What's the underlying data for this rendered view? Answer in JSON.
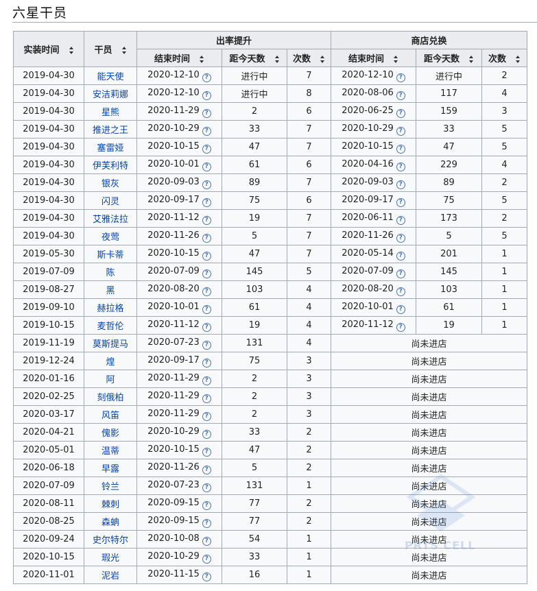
{
  "title": "六星干员",
  "headers": {
    "implement": "实装时间",
    "operator": "干员",
    "rateup_group": "出率提升",
    "shop_group": "商店兑换",
    "end_time": "结束时间",
    "days_ago": "距今天数",
    "count": "次数"
  },
  "no_shop": "尚未进店",
  "watermark": "PRTS CELL",
  "colors": {
    "ongoing": "#148014",
    "long": "#dd3333",
    "link": "#0645ad"
  },
  "rows": [
    {
      "impl": "2019-04-30",
      "name": "能天使",
      "r_end": "2020-12-10",
      "r_days": "进行中",
      "r_cnt": "7",
      "s_end": "2020-12-10",
      "s_days": "进行中",
      "s_cnt": "2"
    },
    {
      "impl": "2019-04-30",
      "name": "安洁莉娜",
      "r_end": "2020-12-10",
      "r_days": "进行中",
      "r_cnt": "8",
      "s_end": "2020-08-06",
      "s_days": "117",
      "s_cnt": "4"
    },
    {
      "impl": "2019-04-30",
      "name": "星熊",
      "r_end": "2020-11-29",
      "r_days": "2",
      "r_cnt": "6",
      "s_end": "2020-06-25",
      "s_days": "159",
      "s_cnt": "3"
    },
    {
      "impl": "2019-04-30",
      "name": "推进之王",
      "r_end": "2020-10-29",
      "r_days": "33",
      "r_cnt": "7",
      "s_end": "2020-10-29",
      "s_days": "33",
      "s_cnt": "5"
    },
    {
      "impl": "2019-04-30",
      "name": "塞雷娅",
      "r_end": "2020-10-15",
      "r_days": "47",
      "r_cnt": "7",
      "s_end": "2020-10-15",
      "s_days": "47",
      "s_cnt": "5"
    },
    {
      "impl": "2019-04-30",
      "name": "伊芙利特",
      "r_end": "2020-10-01",
      "r_days": "61",
      "r_cnt": "6",
      "s_end": "2020-04-16",
      "s_days": "229",
      "s_cnt": "4"
    },
    {
      "impl": "2019-04-30",
      "name": "银灰",
      "r_end": "2020-09-03",
      "r_days": "89",
      "r_cnt": "7",
      "s_end": "2020-09-03",
      "s_days": "89",
      "s_cnt": "2"
    },
    {
      "impl": "2019-04-30",
      "name": "闪灵",
      "r_end": "2020-09-17",
      "r_days": "75",
      "r_cnt": "6",
      "s_end": "2020-09-17",
      "s_days": "75",
      "s_cnt": "5"
    },
    {
      "impl": "2019-04-30",
      "name": "艾雅法拉",
      "r_end": "2020-11-12",
      "r_days": "19",
      "r_cnt": "7",
      "s_end": "2020-06-11",
      "s_days": "173",
      "s_cnt": "2"
    },
    {
      "impl": "2019-04-30",
      "name": "夜莺",
      "r_end": "2020-11-26",
      "r_days": "5",
      "r_cnt": "7",
      "s_end": "2020-11-26",
      "s_days": "5",
      "s_cnt": "5"
    },
    {
      "impl": "2019-05-30",
      "name": "斯卡蒂",
      "r_end": "2020-10-15",
      "r_days": "47",
      "r_cnt": "7",
      "s_end": "2020-05-14",
      "s_days": "201",
      "s_cnt": "1"
    },
    {
      "impl": "2019-07-09",
      "name": "陈",
      "r_end": "2020-07-09",
      "r_days": "145",
      "r_cnt": "5",
      "s_end": "2020-07-09",
      "s_days": "145",
      "s_cnt": "1"
    },
    {
      "impl": "2019-08-27",
      "name": "黑",
      "r_end": "2020-08-20",
      "r_days": "103",
      "r_cnt": "4",
      "s_end": "2020-08-20",
      "s_days": "103",
      "s_cnt": "1"
    },
    {
      "impl": "2019-09-10",
      "name": "赫拉格",
      "r_end": "2020-10-01",
      "r_days": "61",
      "r_cnt": "4",
      "s_end": "2020-10-01",
      "s_days": "61",
      "s_cnt": "1"
    },
    {
      "impl": "2019-10-15",
      "name": "麦哲伦",
      "r_end": "2020-11-12",
      "r_days": "19",
      "r_cnt": "4",
      "s_end": "2020-11-12",
      "s_days": "19",
      "s_cnt": "1"
    },
    {
      "impl": "2019-11-19",
      "name": "莫斯提马",
      "r_end": "2020-07-23",
      "r_days": "131",
      "r_cnt": "4"
    },
    {
      "impl": "2019-12-24",
      "name": "煌",
      "r_end": "2020-09-17",
      "r_days": "75",
      "r_cnt": "3"
    },
    {
      "impl": "2020-01-16",
      "name": "阿",
      "r_end": "2020-11-29",
      "r_days": "2",
      "r_cnt": "3"
    },
    {
      "impl": "2020-02-25",
      "name": "刻俄柏",
      "r_end": "2020-11-29",
      "r_days": "2",
      "r_cnt": "3"
    },
    {
      "impl": "2020-03-17",
      "name": "风笛",
      "r_end": "2020-11-29",
      "r_days": "2",
      "r_cnt": "3"
    },
    {
      "impl": "2020-04-21",
      "name": "傀影",
      "r_end": "2020-10-29",
      "r_days": "33",
      "r_cnt": "2"
    },
    {
      "impl": "2020-05-01",
      "name": "温蒂",
      "r_end": "2020-10-15",
      "r_days": "47",
      "r_cnt": "2"
    },
    {
      "impl": "2020-06-18",
      "name": "早露",
      "r_end": "2020-11-26",
      "r_days": "5",
      "r_cnt": "2"
    },
    {
      "impl": "2020-07-09",
      "name": "铃兰",
      "r_end": "2020-07-23",
      "r_days": "131",
      "r_cnt": "1"
    },
    {
      "impl": "2020-08-11",
      "name": "棘刺",
      "r_end": "2020-09-15",
      "r_days": "77",
      "r_cnt": "2"
    },
    {
      "impl": "2020-08-25",
      "name": "森蚺",
      "r_end": "2020-09-15",
      "r_days": "77",
      "r_cnt": "2"
    },
    {
      "impl": "2020-09-24",
      "name": "史尔特尔",
      "r_end": "2020-10-08",
      "r_days": "54",
      "r_cnt": "1"
    },
    {
      "impl": "2020-10-15",
      "name": "瑕光",
      "r_end": "2020-10-29",
      "r_days": "33",
      "r_cnt": "1"
    },
    {
      "impl": "2020-11-01",
      "name": "泥岩",
      "r_end": "2020-11-15",
      "r_days": "16",
      "r_cnt": "1"
    }
  ]
}
